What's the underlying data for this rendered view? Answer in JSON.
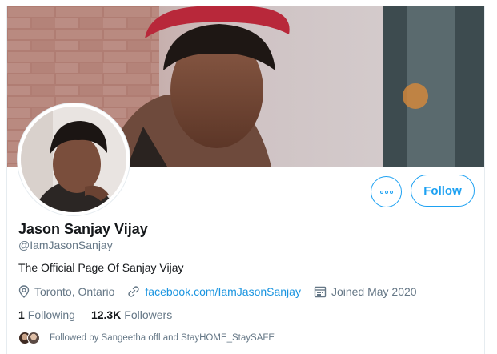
{
  "profile": {
    "display_name": "Jason Sanjay Vijay",
    "handle": "@IamJasonSanjay",
    "bio": "The Official Page Of Sanjay Vijay",
    "location": "Toronto, Ontario",
    "website": "facebook.com/IamJasonSanjay",
    "joined": "Joined May 2020"
  },
  "actions": {
    "follow_label": "Follow",
    "more_icon": "ellipsis-icon"
  },
  "stats": {
    "following_count": "1",
    "following_label": "Following",
    "followers_count": "12.3K",
    "followers_label": "Followers"
  },
  "followed_by": "Followed by Sangeetha offl and StayHOME_StaySAFE",
  "icons": {
    "location": "location-pin-icon",
    "link": "link-icon",
    "joined": "calendar-icon"
  },
  "colors": {
    "accent": "#1da1f2",
    "link": "#1b95e0",
    "secondary_text": "#657786",
    "primary_text": "#14171a"
  }
}
